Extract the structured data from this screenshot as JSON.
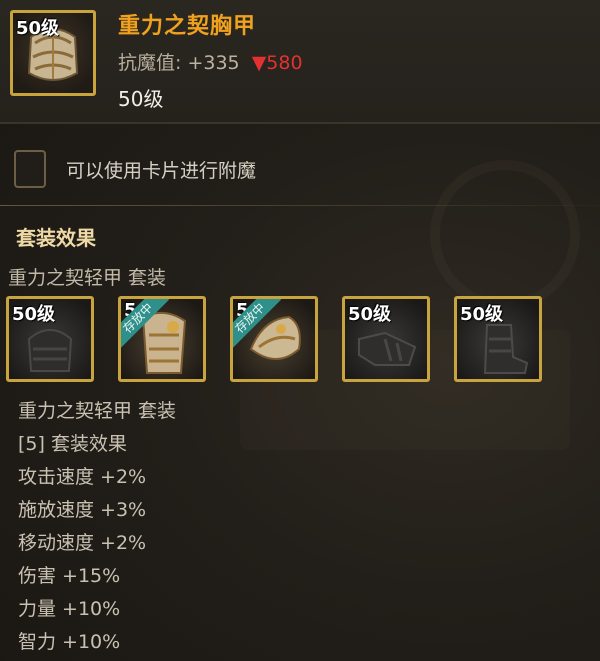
{
  "item": {
    "level_badge": "50级",
    "name": "重力之契胸甲",
    "stat_label": "抗魔值:",
    "stat_value": "+335",
    "stat_compare": "▼580",
    "level_text": "50级",
    "icon": "chest-armor-icon"
  },
  "enchant": {
    "text": "可以使用卡片进行附魔"
  },
  "set": {
    "section_title": "套装效果",
    "set_name": "重力之契轻甲 套装",
    "slots": [
      {
        "badge": "50级",
        "ribbon": "",
        "icon": "helmet-armor-icon"
      },
      {
        "badge": "5",
        "ribbon": "存放中",
        "icon": "gold-chest-armor-icon"
      },
      {
        "badge": "5",
        "ribbon": "存放中",
        "icon": "gold-shoulder-armor-icon"
      },
      {
        "badge": "50级",
        "ribbon": "",
        "icon": "gauntlet-armor-icon"
      },
      {
        "badge": "50级",
        "ribbon": "",
        "icon": "boots-armor-icon"
      }
    ],
    "bonus_lines": [
      "重力之契轻甲 套装",
      "[5] 套装效果",
      "攻击速度 +2%",
      "施放速度 +3%",
      "移动速度 +2%",
      "伤害 +15%",
      "力量 +10%",
      "智力 +10%"
    ]
  },
  "colors": {
    "item_name": "#f0a21e",
    "frame_gold": "#c9a43c",
    "stat_down": "#e33131",
    "ribbon": "#2f8f8a"
  }
}
